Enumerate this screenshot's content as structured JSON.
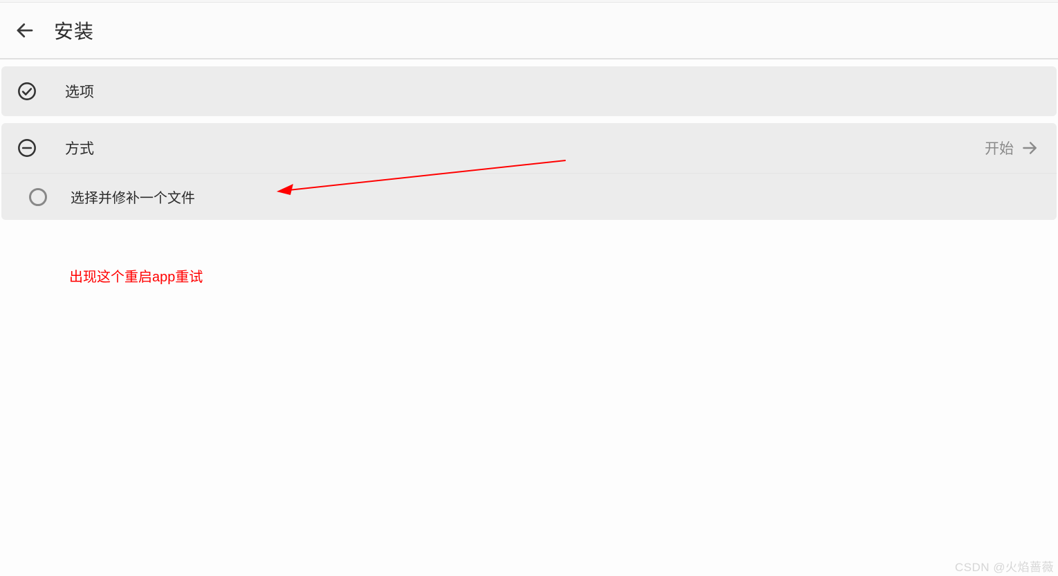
{
  "header": {
    "title": "安装"
  },
  "sections": {
    "options": {
      "label": "选项"
    },
    "method": {
      "label": "方式",
      "action_label": "开始",
      "item": {
        "label": "选择并修补一个文件"
      }
    }
  },
  "annotation": {
    "text": "出现这个重启app重试"
  },
  "watermark": "CSDN @火焰蔷薇"
}
